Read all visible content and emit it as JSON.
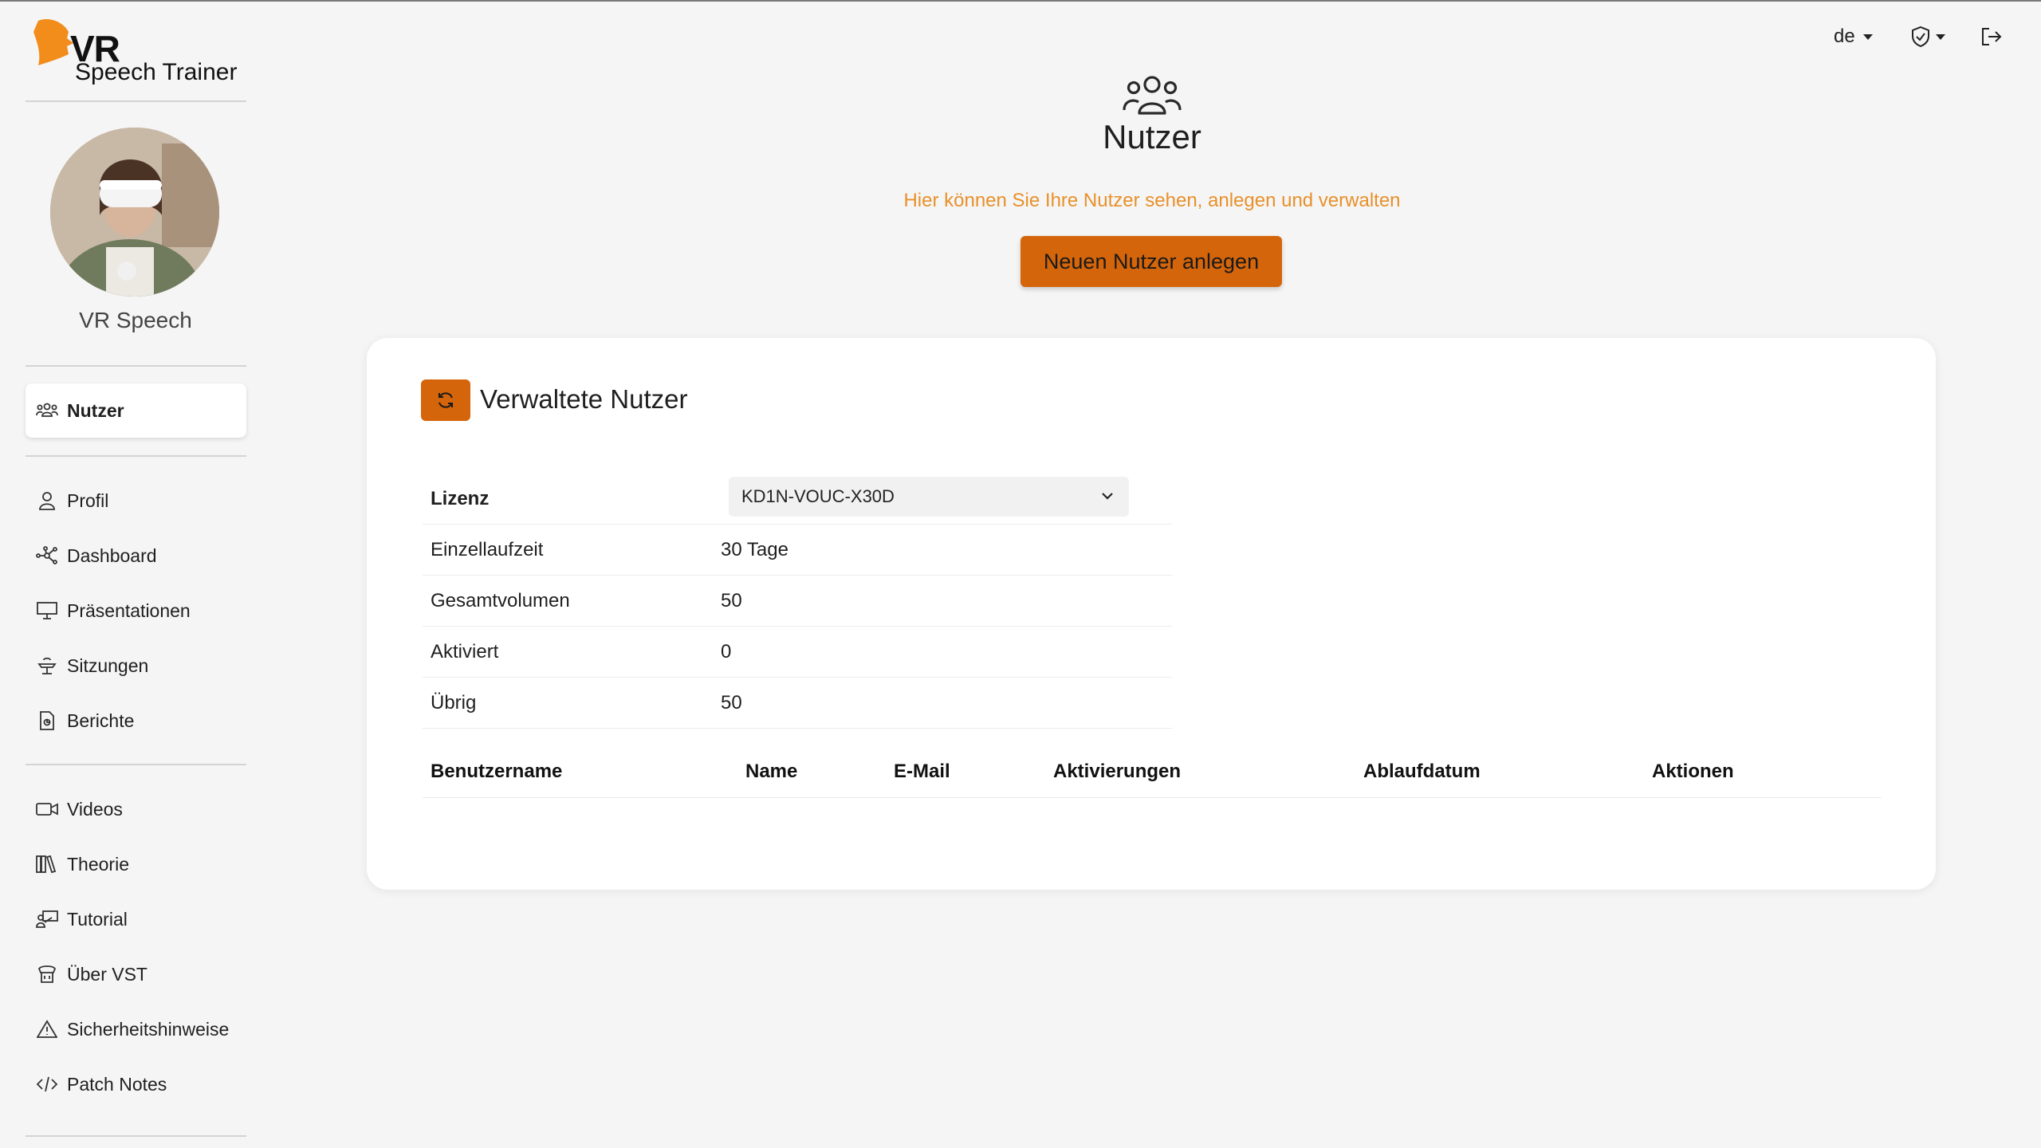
{
  "app": {
    "logo_main": "VR",
    "logo_sub": "Speech Trainer",
    "user_name": "VR Speech"
  },
  "sidebar": {
    "items": [
      {
        "label": "Nutzer",
        "icon": "users-icon"
      },
      {
        "label": "Profil",
        "icon": "person-icon"
      },
      {
        "label": "Dashboard",
        "icon": "nodes-icon"
      },
      {
        "label": "Präsentationen",
        "icon": "presentation-icon"
      },
      {
        "label": "Sitzungen",
        "icon": "podium-icon"
      },
      {
        "label": "Berichte",
        "icon": "report-icon"
      },
      {
        "label": "Videos",
        "icon": "video-icon"
      },
      {
        "label": "Theorie",
        "icon": "books-icon"
      },
      {
        "label": "Tutorial",
        "icon": "tutorial-icon"
      },
      {
        "label": "Über VST",
        "icon": "info-box-icon"
      },
      {
        "label": "Sicherheitshinweise",
        "icon": "warning-icon"
      },
      {
        "label": "Patch Notes",
        "icon": "code-icon"
      }
    ]
  },
  "topbar": {
    "language": "de"
  },
  "header": {
    "title": "Nutzer",
    "subtitle": "Hier können Sie Ihre Nutzer sehen, anlegen und verwalten",
    "create_button": "Neuen Nutzer anlegen"
  },
  "card": {
    "title": "Verwaltete Nutzer",
    "license_label": "Lizenz",
    "license_value": "KD1N-VOUC-X30D",
    "info_rows": [
      {
        "key": "Einzellaufzeit",
        "value": "30 Tage"
      },
      {
        "key": "Gesamtvolumen",
        "value": "50"
      },
      {
        "key": "Aktiviert",
        "value": "0"
      },
      {
        "key": "Übrig",
        "value": "50"
      }
    ],
    "table_headers": [
      "Benutzername",
      "Name",
      "E-Mail",
      "Aktivierungen",
      "Ablaufdatum",
      "Aktionen"
    ]
  },
  "colors": {
    "accent": "#d5650a",
    "subtitle": "#e8902a",
    "background": "#f5f5f5"
  }
}
